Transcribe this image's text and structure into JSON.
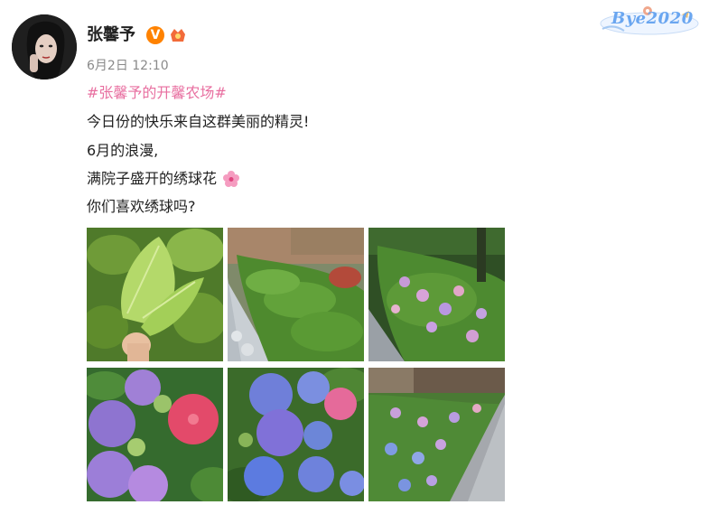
{
  "header": {
    "username": "张馨予",
    "timestamp": "6月2日 12:10",
    "verified_icon": "V",
    "badge_text": "Bye2020"
  },
  "post": {
    "hashtag": "#张馨予的开馨农场#",
    "lines": [
      "今日份的快乐来自这群美丽的精灵!",
      "6月的浪漫,",
      "满院子盛开的绣球花",
      "你们喜欢绣球吗?"
    ],
    "emoji_icon": "flower-icon"
  },
  "colors": {
    "hashtag": "#e86fa0",
    "text": "#222222",
    "meta": "#8a8a8a",
    "verified": "#ff8200",
    "badge_text": "#6aa6f0"
  },
  "images": [
    {
      "name": "green-leaves"
    },
    {
      "name": "garden-path-greens"
    },
    {
      "name": "hydrangea-bushes-path"
    },
    {
      "name": "purple-pink-hydrangeas"
    },
    {
      "name": "blue-hydrangeas"
    },
    {
      "name": "hydrangea-path-rows"
    }
  ]
}
